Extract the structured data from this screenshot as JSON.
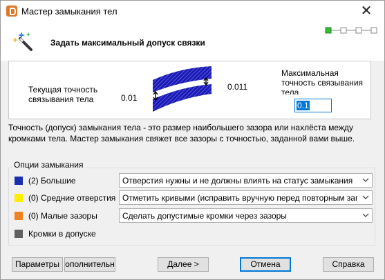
{
  "window": {
    "title": "Мастер замыкания тел",
    "close_glyph": "✕"
  },
  "header": {
    "title": "Задать максимальный допуск связки",
    "wizard_icon": "wizard-wand-icon",
    "steps": 4,
    "current_step": 1
  },
  "panel": {
    "current_label": "Текущая точность связывания тела",
    "current_value": "0.01",
    "gap_value": "0.011",
    "max_label": "Максимальная точность связывания тела",
    "max_value": "0.1"
  },
  "description": "Точность (допуск) замыкания тела - это размер наибольшего зазора или нахлёста между кромками тела. Мастер замыкания свяжет все зазоры с точностью, заданной вами выше.",
  "options": {
    "title": "Опции замыкания",
    "rows": [
      {
        "label": "(2) Большие",
        "color": "#1a2fb0",
        "select": "Отверстия нужны и не должны влиять на статус замыкания"
      },
      {
        "label": "(0) Средние отверстия",
        "color": "#ffee00",
        "select": "Отметить кривыми (исправить вручную перед повторным зап"
      },
      {
        "label": "(0) Малые зазоры",
        "color": "#f08020",
        "select": "Сделать допустимые кромки через зазоры"
      },
      {
        "label": "Кромки в допуске",
        "color": "#606060"
      }
    ]
  },
  "buttons": {
    "params": "Параметры",
    "extra": "ополнительн",
    "next": "Далее >",
    "cancel": "Отмена",
    "help": "Справка"
  }
}
